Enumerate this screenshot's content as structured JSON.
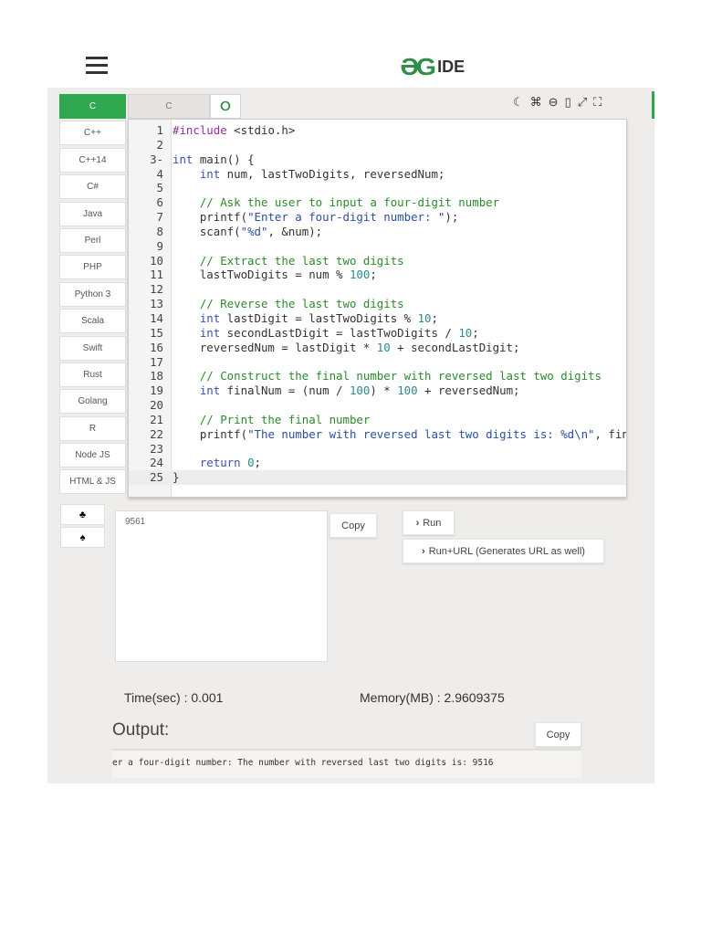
{
  "header": {
    "logo_text": "IDE",
    "brand_color": "#2f8d46"
  },
  "languages": [
    "C",
    "C++",
    "C++14",
    "C#",
    "Java",
    "Perl",
    "PHP",
    "Python 3",
    "Scala",
    "Swift",
    "Rust",
    "Golang",
    "R",
    "Node JS",
    "HTML & JS"
  ],
  "active_language": "C",
  "tabs": {
    "file_tab": "C",
    "add_tab": "+"
  },
  "toolbar": [
    "moon-icon",
    "command-icon",
    "zoom-icon",
    "file-icon",
    "expand-icon",
    "fullscreen-icon"
  ],
  "code": [
    [
      [
        "#include",
        "pp"
      ],
      [
        " <stdio.h>",
        "p"
      ]
    ],
    [],
    [
      [
        "int",
        "kw"
      ],
      [
        " main() {",
        "p"
      ]
    ],
    [
      [
        "    int",
        "kw"
      ],
      [
        " num, lastTwoDigits, reversedNum;",
        "p"
      ]
    ],
    [],
    [
      [
        "    // Ask the user to input a four-digit number",
        "cm"
      ]
    ],
    [
      [
        "    printf(",
        "p"
      ],
      [
        "\"Enter a four-digit number: \"",
        "str"
      ],
      [
        ");",
        "p"
      ]
    ],
    [
      [
        "    scanf(",
        "p"
      ],
      [
        "\"%d\"",
        "str"
      ],
      [
        ", &num);",
        "p"
      ]
    ],
    [],
    [
      [
        "    // Extract the last two digits",
        "cm"
      ]
    ],
    [
      [
        "    lastTwoDigits = num % ",
        "p"
      ],
      [
        "100",
        "n"
      ],
      [
        ";",
        "p"
      ]
    ],
    [],
    [
      [
        "    // Reverse the last two digits",
        "cm"
      ]
    ],
    [
      [
        "    int",
        "kw"
      ],
      [
        " lastDigit = lastTwoDigits % ",
        "p"
      ],
      [
        "10",
        "n"
      ],
      [
        ";",
        "p"
      ]
    ],
    [
      [
        "    int",
        "kw"
      ],
      [
        " secondLastDigit = lastTwoDigits / ",
        "p"
      ],
      [
        "10",
        "n"
      ],
      [
        ";",
        "p"
      ]
    ],
    [
      [
        "    reversedNum = lastDigit * ",
        "p"
      ],
      [
        "10",
        "n"
      ],
      [
        " + secondLastDigit;",
        "p"
      ]
    ],
    [],
    [
      [
        "    // Construct the final number with reversed last two digits",
        "cm"
      ]
    ],
    [
      [
        "    int",
        "kw"
      ],
      [
        " finalNum = (num / ",
        "p"
      ],
      [
        "100",
        "n"
      ],
      [
        ") * ",
        "p"
      ],
      [
        "100",
        "n"
      ],
      [
        " + reversedNum;",
        "p"
      ]
    ],
    [],
    [
      [
        "    // Print the final number",
        "cm"
      ]
    ],
    [
      [
        "    printf(",
        "p"
      ],
      [
        "\"The number with reversed last two digits is: %d\\n\"",
        "str"
      ],
      [
        ", finalNum);",
        "p"
      ]
    ],
    [],
    [
      [
        "    return",
        "kw"
      ],
      [
        " ",
        "p"
      ],
      [
        "0",
        "n"
      ],
      [
        ";",
        "p"
      ]
    ],
    [
      [
        "}",
        "p"
      ]
    ]
  ],
  "stdin": "9561",
  "buttons": {
    "copy_input": "Copy",
    "run": "Run",
    "run_url": "Run+URL (Generates URL as well)",
    "copy_output": "Copy"
  },
  "stats": {
    "time": "Time(sec) : 0.001",
    "memory": "Memory(MB) : 2.9609375"
  },
  "output": {
    "label": "Output:",
    "text": "er a four-digit number: The number with reversed last two digits is: 9516"
  }
}
